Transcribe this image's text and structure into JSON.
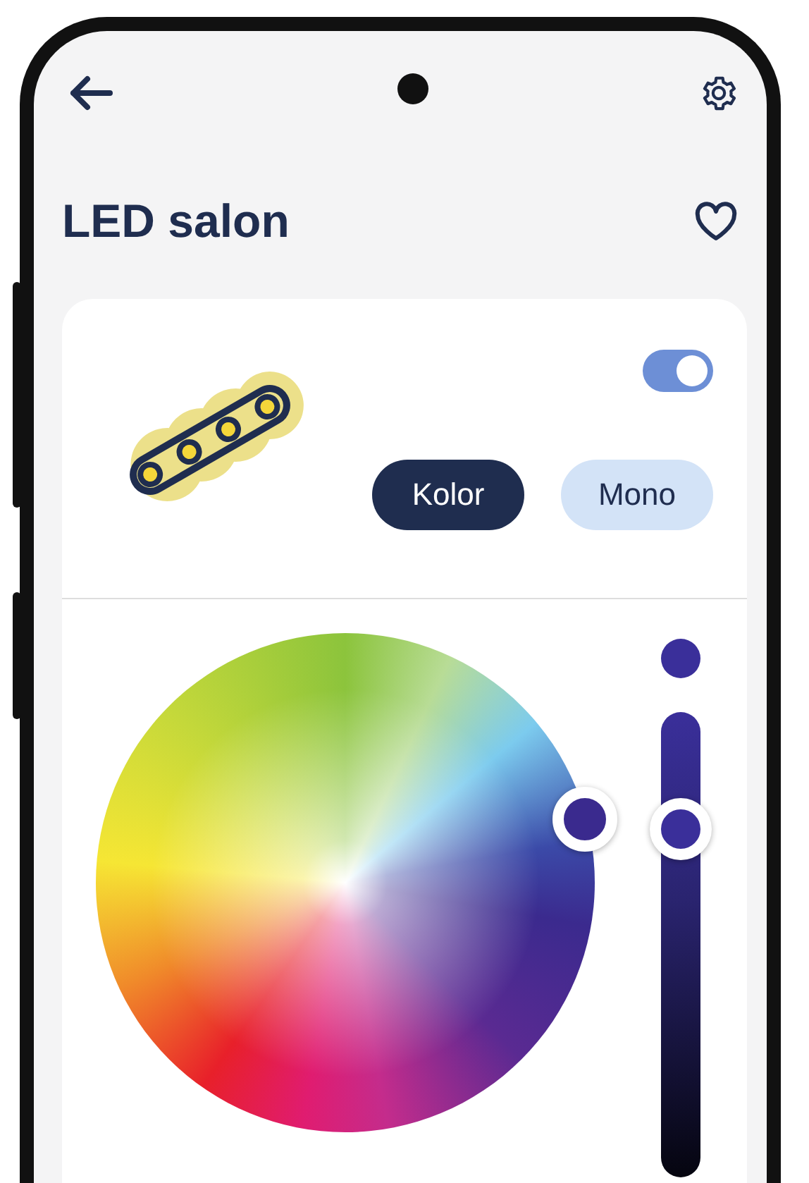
{
  "screen": {
    "title": "LED salon"
  },
  "device": {
    "power_on": true
  },
  "modes": [
    {
      "label": "Kolor",
      "selected": true
    },
    {
      "label": "Mono",
      "selected": false
    }
  ],
  "brightness": {
    "level": 0.75
  }
}
